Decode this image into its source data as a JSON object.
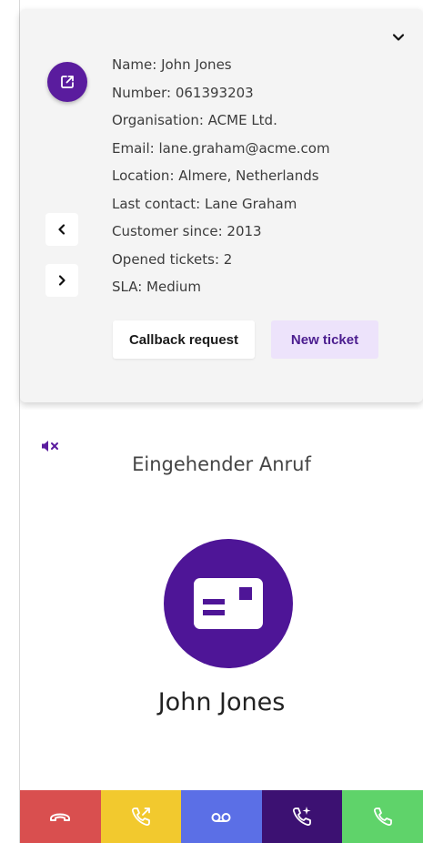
{
  "customer_card": {
    "fields": [
      {
        "text": "Name: John Jones"
      },
      {
        "text": "Number: 061393203"
      },
      {
        "text": "Organisation: ACME Ltd."
      },
      {
        "text": "Email: lane.graham@acme.com"
      },
      {
        "text": "Location: Almere, Netherlands"
      },
      {
        "text": "Last contact:  Lane Graham"
      },
      {
        "text": "Customer since: 2013"
      },
      {
        "text": "Opened tickets: 2"
      },
      {
        "text": "SLA: Medium"
      }
    ],
    "callback_label": "Callback request",
    "new_ticket_label": "New ticket",
    "icons": {
      "open": "external-link-icon",
      "collapse": "chevron-down-icon",
      "prev": "chevron-left-icon",
      "next": "chevron-right-icon"
    }
  },
  "call": {
    "status": "Eingehender Anruf",
    "caller_name": "John Jones",
    "mute_icon": "speaker-muted-icon",
    "avatar_icon": "contact-card-icon"
  },
  "actions": [
    {
      "icon": "hang-up-icon",
      "color": "#d94f4f"
    },
    {
      "icon": "forward-call-icon",
      "color": "#f2c92e"
    },
    {
      "icon": "voicemail-icon",
      "color": "#5b6fe6"
    },
    {
      "icon": "ai-call-icon",
      "color": "#3c1172"
    },
    {
      "icon": "accept-call-icon",
      "color": "#5fd36a"
    }
  ],
  "colors": {
    "accent": "#5a1c9e",
    "card_background": "#f4f4f4",
    "new_ticket_bg": "#ede3fb"
  }
}
